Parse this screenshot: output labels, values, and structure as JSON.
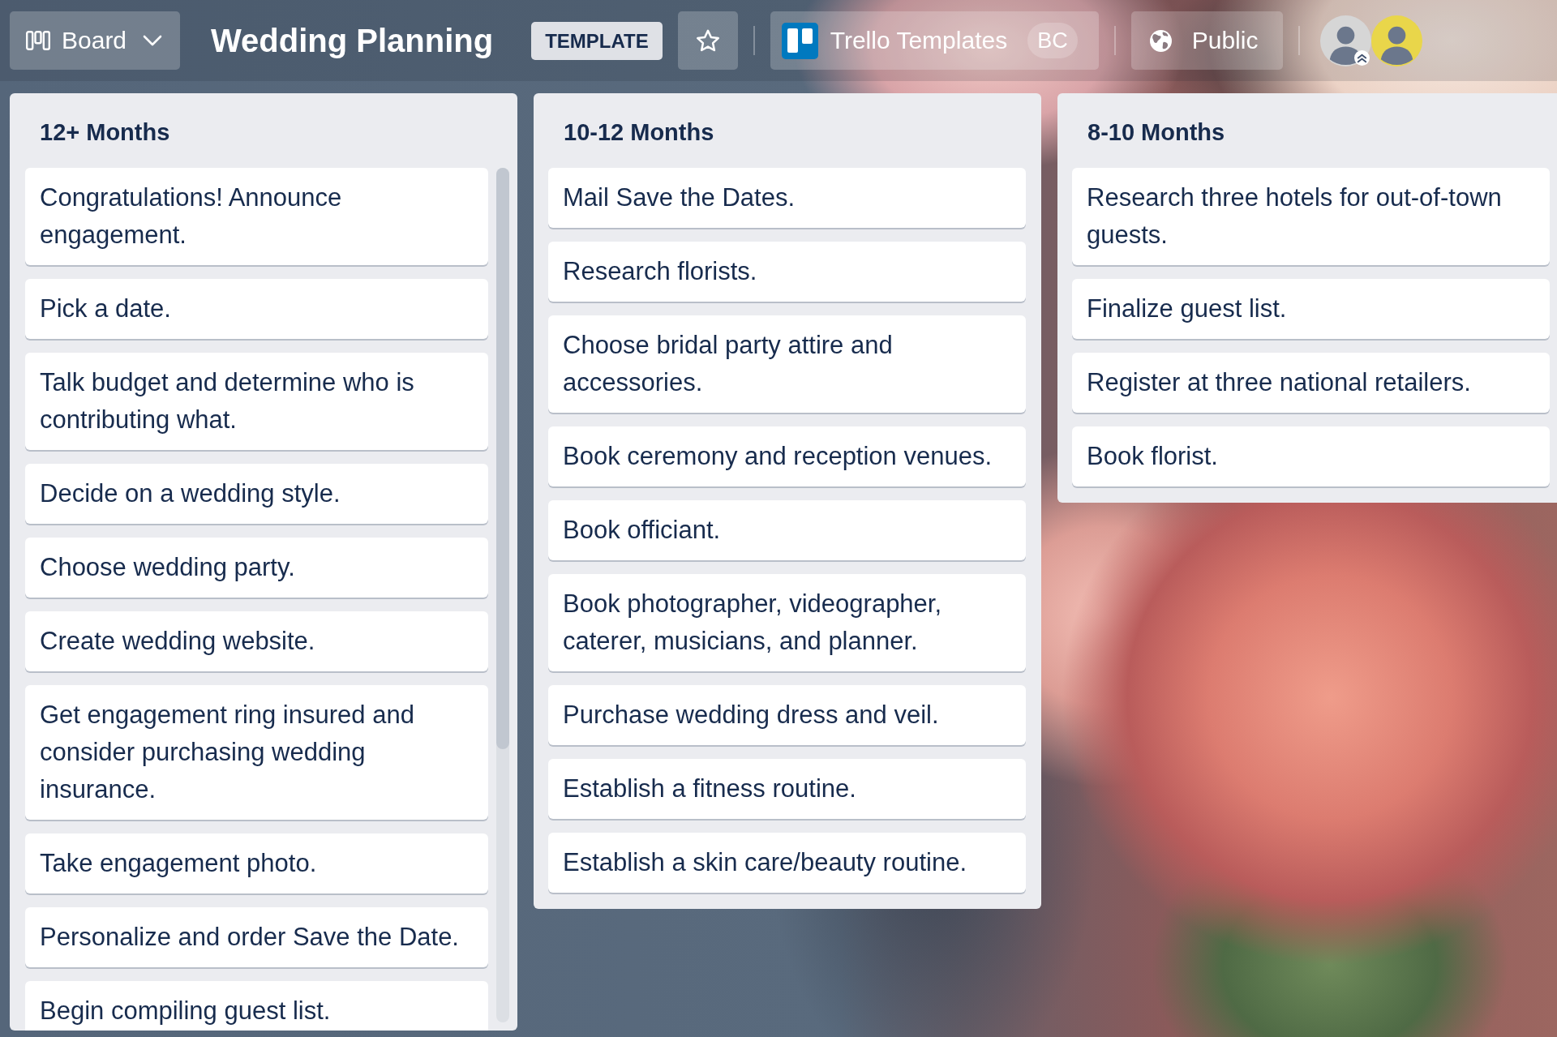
{
  "header": {
    "view_switcher": {
      "label": "Board"
    },
    "title": "Wedding Planning",
    "badge": "TEMPLATE",
    "starred": false,
    "workspace": {
      "name": "Trello Templates",
      "badge": "BC"
    },
    "visibility": {
      "label": "Public"
    },
    "members": [
      {
        "admin": true,
        "color": "#d6d6d6"
      },
      {
        "admin": false,
        "color": "#e9d64a"
      }
    ]
  },
  "lists": [
    {
      "title": "12+ Months",
      "scrollable": true,
      "cards": [
        "Congratulations! Announce engagement.",
        "Pick a date.",
        "Talk budget and determine who is contributing what.",
        "Decide on a wedding style.",
        "Choose wedding party.",
        "Create wedding website.",
        "Get engagement ring insured and consider purchasing wedding insurance.",
        "Take engagement photo.",
        "Personalize and order Save the Date.",
        "Begin compiling guest list."
      ]
    },
    {
      "title": "10-12 Months",
      "scrollable": false,
      "cards": [
        "Mail Save the Dates.",
        "Research florists.",
        "Choose bridal party attire and accessories.",
        "Book ceremony and reception venues.",
        "Book officiant.",
        "Book photographer, videographer, caterer, musicians, and planner.",
        "Purchase wedding dress and veil.",
        "Establish a fitness routine.",
        "Establish a skin care/beauty routine."
      ]
    },
    {
      "title": "8-10 Months",
      "scrollable": false,
      "cards": [
        "Research three hotels for out-of-town guests.",
        "Finalize guest list.",
        "Register at three national retailers.",
        "Book florist."
      ]
    }
  ]
}
